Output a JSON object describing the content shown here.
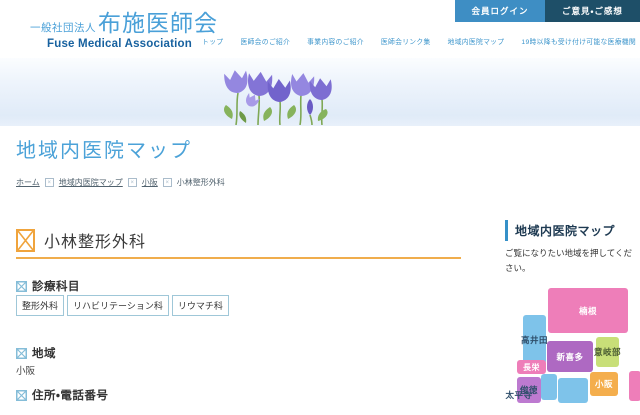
{
  "header": {
    "org_prefix": "一般社団法人",
    "org_name": "布施医師会",
    "org_name_en": "Fuse Medical Association",
    "member_login": "会員ログイン",
    "feedback": "ご意見・ご感想",
    "nav": [
      "トップ",
      "医師会のご紹介",
      "事業内容のご紹介",
      "医師会リンク集",
      "地域内医院マップ",
      "19時以降も受け付け可能な医療機関"
    ]
  },
  "page": {
    "title": "地域内医院マップ",
    "breadcrumb": [
      "ホーム",
      "地域内医院マップ",
      "小阪",
      "小林整形外科"
    ]
  },
  "clinic": {
    "name": "小林整形外科",
    "departments_label": "診療科目",
    "departments": [
      "整形外科",
      "リハビリテーション科",
      "リウマチ科"
    ],
    "area_label": "地域",
    "area": "小阪",
    "address_label": "住所・電話番号"
  },
  "sidebar": {
    "title": "地域内医院マップ",
    "description": "ご覧になりたい地域を押してください。",
    "regions": [
      {
        "name": "楠根",
        "bg": "#ee7eb9",
        "fg": "#ffffff"
      },
      {
        "name": "高井田",
        "bg": "#7ec3ea",
        "fg": "#2e4e6a"
      },
      {
        "name": "新喜多",
        "bg": "#ae69c2",
        "fg": "#ffffff"
      },
      {
        "name": "意岐部",
        "bg": "#c8df78",
        "fg": "#4d5f33"
      },
      {
        "name": "長栄",
        "bg": "#ee7eb9",
        "fg": "#ffffff"
      },
      {
        "name": "俊徳",
        "bg": "#bd7ad0",
        "fg": "#2e4e6a"
      },
      {
        "name": "",
        "bg": "#7ec3ea",
        "fg": "#ffffff"
      },
      {
        "name": "",
        "bg": "#7ec3ea",
        "fg": "#ffffff"
      },
      {
        "name": "小阪",
        "bg": "#f4ae4d",
        "fg": "#ffffff"
      },
      {
        "name": "",
        "bg": "#ee7eb9",
        "fg": "#ffffff"
      },
      {
        "name": "太平寺",
        "bg": "transparent",
        "fg": "#2e4e6a"
      }
    ]
  },
  "colors": {
    "accent_blue": "#4aa0d8",
    "nav_blue": "#3e96cc",
    "login_button_bg": "#3e8ec4",
    "feedback_button_bg": "#1e4f68",
    "heading_underline": "#f0ad4c",
    "sidebar_bar": "#3590c8"
  }
}
